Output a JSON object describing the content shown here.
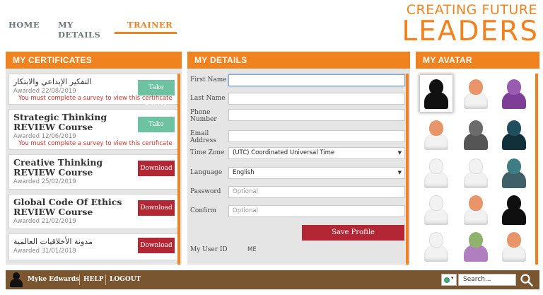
{
  "nav": {
    "home": "HOME",
    "my_details": "MY DETAILS",
    "trainer": "TRAINER"
  },
  "logo": {
    "line1": "CREATING FUTURE",
    "line2": "LEADERS"
  },
  "panels": {
    "certificates_title": "MY CERTIFICATES",
    "details_title": "MY DETAILS",
    "avatar_title": "MY AVATAR"
  },
  "certificates": [
    {
      "title": "التفكير الإبداعي والابتكار",
      "awarded": "Awarded 22/08/2019",
      "message": "You must complete a survey to view this certificate",
      "button": "Take Survey"
    },
    {
      "title": "Strategic Thinking REVIEW Course",
      "awarded": "Awarded 12/06/2019",
      "message": "You must complete a survey to view this certificate",
      "button": "Take Survey"
    },
    {
      "title": "Creative Thinking REVIEW Course",
      "awarded": "Awarded 25/02/2019",
      "message": "",
      "button": "Download"
    },
    {
      "title": "Global Code Of Ethics REVIEW Course",
      "awarded": "Awarded 21/02/2019",
      "message": "",
      "button": "Download"
    },
    {
      "title": "مدونة الأخلاقيات العالمية",
      "awarded": "Awarded 31/01/2019",
      "message": "",
      "button": "Download"
    }
  ],
  "details": {
    "first_name_label": "First Name",
    "first_name_value": "",
    "last_name_label": "Last Name",
    "last_name_value": "",
    "phone_label": "Phone Number",
    "phone_value": "",
    "email_label": "Email Address",
    "email_value": "",
    "timezone_label": "Time Zone",
    "timezone_value": "(UTC) Coordinated Universal Time",
    "language_label": "Language",
    "language_value": "English",
    "password_label": "Password",
    "password_placeholder": "Optional",
    "confirm_label": "Confirm",
    "confirm_placeholder": "Optional",
    "save_button": "Save Profile",
    "user_id_label": "My User ID",
    "user_id_value": "ME"
  },
  "avatars": [
    {
      "name": "avatar-black-hijab",
      "head": "#111111",
      "body": "#111111",
      "selected": true
    },
    {
      "name": "avatar-man-white-cap",
      "head": "#e8956a",
      "body": "#f2f2f2"
    },
    {
      "name": "avatar-purple-hijab",
      "head": "#9a5ab0",
      "body": "#7e3d96"
    },
    {
      "name": "avatar-man-orange",
      "head": "#e8956a",
      "body": "#f2f2f2"
    },
    {
      "name": "avatar-grey-hijab",
      "head": "#6b6b6b",
      "body": "#555555"
    },
    {
      "name": "avatar-teal-niqab",
      "head": "#1f4f5f",
      "body": "#12303a"
    },
    {
      "name": "avatar-man-ghutra",
      "head": "#f2f2f2",
      "body": "#f2f2f2"
    },
    {
      "name": "avatar-man-ghutra-beard",
      "head": "#f2f2f2",
      "body": "#f2f2f2"
    },
    {
      "name": "avatar-teal-hijab",
      "head": "#3d7d86",
      "body": "#3f5f69"
    },
    {
      "name": "avatar-man-red-ghutra",
      "head": "#f2f2f2",
      "body": "#f2f2f2"
    },
    {
      "name": "avatar-man-beard",
      "head": "#e8956a",
      "body": "#f2f2f2"
    },
    {
      "name": "avatar-black-niqab",
      "head": "#0f0f0f",
      "body": "#0f0f0f"
    },
    {
      "name": "avatar-man-ghutra-2",
      "head": "#f2f2f2",
      "body": "#f2f2f2"
    },
    {
      "name": "avatar-green-hijab",
      "head": "#8fb36c",
      "body": "#b07fc0"
    },
    {
      "name": "avatar-man-glasses",
      "head": "#e8956a",
      "body": "#f2f2f2"
    }
  ],
  "footer": {
    "user_name": "Myke Edwards",
    "help": "HELP",
    "logout": "LOGOUT",
    "search_placeholder": "Search..."
  },
  "colors": {
    "accent_orange": "#f0831f",
    "download_red": "#b32734",
    "survey_green": "#6dc2a2",
    "footer_brown": "#7a5630"
  }
}
